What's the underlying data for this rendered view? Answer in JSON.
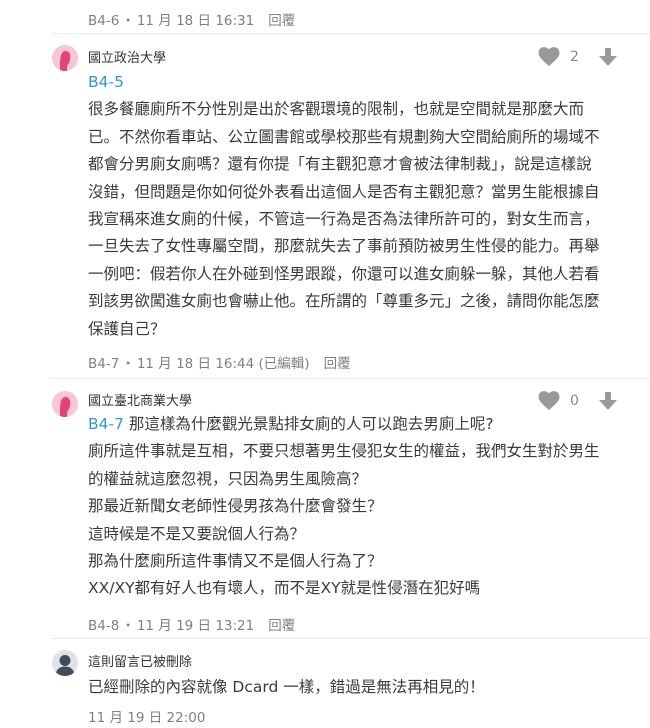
{
  "top_meta": {
    "floor": "B4-6",
    "dot": "・",
    "time": "11 月 18 日 16:31",
    "reply": "回覆"
  },
  "comments": [
    {
      "school": "國立政治大學",
      "likes": "2",
      "floor_ref": "B4-5",
      "lines": [
        "很多餐廳廁所不分性別是出於客觀環境的限制，也就是空間就是那麼大而",
        "已。不然你看車站、公立圖書館或學校那些有規劃夠大空間給廁所的場域不",
        "都會分男廁女廁嗎？還有你提「有主觀犯意才會被法律制裁」，說是這樣說",
        "沒錯，但問題是你如何從外表看出這個人是否有主觀犯意？當男生能根據自",
        "我宣稱來進女廁的什候，不管這一行為是否為法律所許可的，對女生而言，",
        "一旦失去了女性專屬空間，那麼就失去了事前預防被男生性侵的能力。再舉",
        "一例吧：假若你人在外碰到怪男跟蹤，你還可以進女廁躲一躲，其他人若看",
        "到該男欲闖進女廁也會嚇止他。在所謂的「尊重多元」之後，請問你能怎麼",
        "保護自己？"
      ],
      "meta": {
        "floor": "B4-7",
        "dot": "・",
        "time": "11 月 18 日 16:44 (已編輯)",
        "reply": "回覆"
      }
    },
    {
      "school": "國立臺北商業大學",
      "likes": "0",
      "floor_ref": "B4-7",
      "first_line_rest": " 那這樣為什麼觀光景點排女廁的人可以跑去男廁上呢?",
      "lines": [
        "廁所這件事就是互相，不要只想著男生侵犯女生的權益，我們女生對於男生",
        "的權益就這麼忽視，只因為男生風險高？",
        "那最近新聞女老師性侵男孩為什麼會發生？",
        "這時候是不是又要說個人行為？",
        "那為什麼廁所這件事情又不是個人行為了？",
        "XX/XY都有好人也有壞人，而不是XY就是性侵潛在犯好嗎"
      ],
      "meta": {
        "floor": "B4-8",
        "dot": "・",
        "time": "11 月 19 日 13:21",
        "reply": "回覆"
      }
    },
    {
      "school": "這則留言已被刪除",
      "lines": [
        "已經刪除的內容就像 Dcard 一樣，錯過是無法再相見的！"
      ],
      "meta": {
        "time": "11 月 19 日 22:00"
      }
    }
  ],
  "colors": {
    "accent": "#3397cf",
    "meta": "#808080",
    "avatar_pink": "#f7c7d6"
  },
  "icons": {
    "like": "heart-icon",
    "dislike": "arrow-down-icon",
    "avatar": "female-avatar-icon",
    "deleted_avatar": "person-silhouette-icon"
  }
}
